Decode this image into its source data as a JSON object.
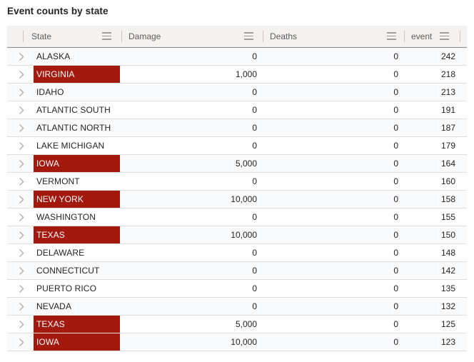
{
  "title": "Event counts by state",
  "colors": {
    "highlight": "#a4190d",
    "header_bg": "#f3f2f1",
    "row_alt_bg": "#f9fafb",
    "text": "#252423",
    "header_text": "#605e5c",
    "grid_line": "#e1dfdd"
  },
  "table": {
    "columns": [
      {
        "key": "state",
        "label": "State",
        "align": "left",
        "menu_icon": "hamburger-menu-icon"
      },
      {
        "key": "damage",
        "label": "Damage",
        "align": "right",
        "menu_icon": "hamburger-menu-icon"
      },
      {
        "key": "deaths",
        "label": "Deaths",
        "align": "right",
        "menu_icon": "hamburger-menu-icon"
      },
      {
        "key": "event",
        "label": "event",
        "align": "right",
        "menu_icon": "hamburger-menu-icon"
      }
    ],
    "expand_icon": "chevron-right-icon",
    "rows": [
      {
        "state": "ALASKA",
        "damage": "0",
        "deaths": "0",
        "event": "242",
        "highlighted": false
      },
      {
        "state": "VIRGINIA",
        "damage": "1,000",
        "deaths": "0",
        "event": "218",
        "highlighted": true
      },
      {
        "state": "IDAHO",
        "damage": "0",
        "deaths": "0",
        "event": "213",
        "highlighted": false
      },
      {
        "state": "ATLANTIC SOUTH",
        "damage": "0",
        "deaths": "0",
        "event": "191",
        "highlighted": false
      },
      {
        "state": "ATLANTIC NORTH",
        "damage": "0",
        "deaths": "0",
        "event": "187",
        "highlighted": false
      },
      {
        "state": "LAKE MICHIGAN",
        "damage": "0",
        "deaths": "0",
        "event": "179",
        "highlighted": false
      },
      {
        "state": "IOWA",
        "damage": "5,000",
        "deaths": "0",
        "event": "164",
        "highlighted": true
      },
      {
        "state": "VERMONT",
        "damage": "0",
        "deaths": "0",
        "event": "160",
        "highlighted": false
      },
      {
        "state": "NEW YORK",
        "damage": "10,000",
        "deaths": "0",
        "event": "158",
        "highlighted": true
      },
      {
        "state": "WASHINGTON",
        "damage": "0",
        "deaths": "0",
        "event": "155",
        "highlighted": false
      },
      {
        "state": "TEXAS",
        "damage": "10,000",
        "deaths": "0",
        "event": "150",
        "highlighted": true
      },
      {
        "state": "DELAWARE",
        "damage": "0",
        "deaths": "0",
        "event": "148",
        "highlighted": false
      },
      {
        "state": "CONNECTICUT",
        "damage": "0",
        "deaths": "0",
        "event": "142",
        "highlighted": false
      },
      {
        "state": "PUERTO RICO",
        "damage": "0",
        "deaths": "0",
        "event": "135",
        "highlighted": false
      },
      {
        "state": "NEVADA",
        "damage": "0",
        "deaths": "0",
        "event": "132",
        "highlighted": false
      },
      {
        "state": "TEXAS",
        "damage": "5,000",
        "deaths": "0",
        "event": "125",
        "highlighted": true
      },
      {
        "state": "IOWA",
        "damage": "10,000",
        "deaths": "0",
        "event": "123",
        "highlighted": true
      }
    ]
  },
  "chart_data": {
    "type": "table",
    "title": "Event counts by state",
    "columns": [
      "State",
      "Damage",
      "Deaths",
      "event"
    ],
    "rows": [
      [
        "ALASKA",
        0,
        0,
        242
      ],
      [
        "VIRGINIA",
        1000,
        0,
        218
      ],
      [
        "IDAHO",
        0,
        0,
        213
      ],
      [
        "ATLANTIC SOUTH",
        0,
        0,
        191
      ],
      [
        "ATLANTIC NORTH",
        0,
        0,
        187
      ],
      [
        "LAKE MICHIGAN",
        0,
        0,
        179
      ],
      [
        "IOWA",
        5000,
        0,
        164
      ],
      [
        "VERMONT",
        0,
        0,
        160
      ],
      [
        "NEW YORK",
        10000,
        0,
        158
      ],
      [
        "WASHINGTON",
        0,
        0,
        155
      ],
      [
        "TEXAS",
        10000,
        0,
        150
      ],
      [
        "DELAWARE",
        0,
        0,
        148
      ],
      [
        "CONNECTICUT",
        0,
        0,
        142
      ],
      [
        "PUERTO RICO",
        0,
        0,
        135
      ],
      [
        "NEVADA",
        0,
        0,
        132
      ],
      [
        "TEXAS",
        5000,
        0,
        125
      ],
      [
        "IOWA",
        10000,
        0,
        123
      ]
    ],
    "highlighted_rows": [
      1,
      6,
      8,
      10,
      15,
      16
    ],
    "sort": {
      "column": "event",
      "direction": "descending"
    }
  }
}
